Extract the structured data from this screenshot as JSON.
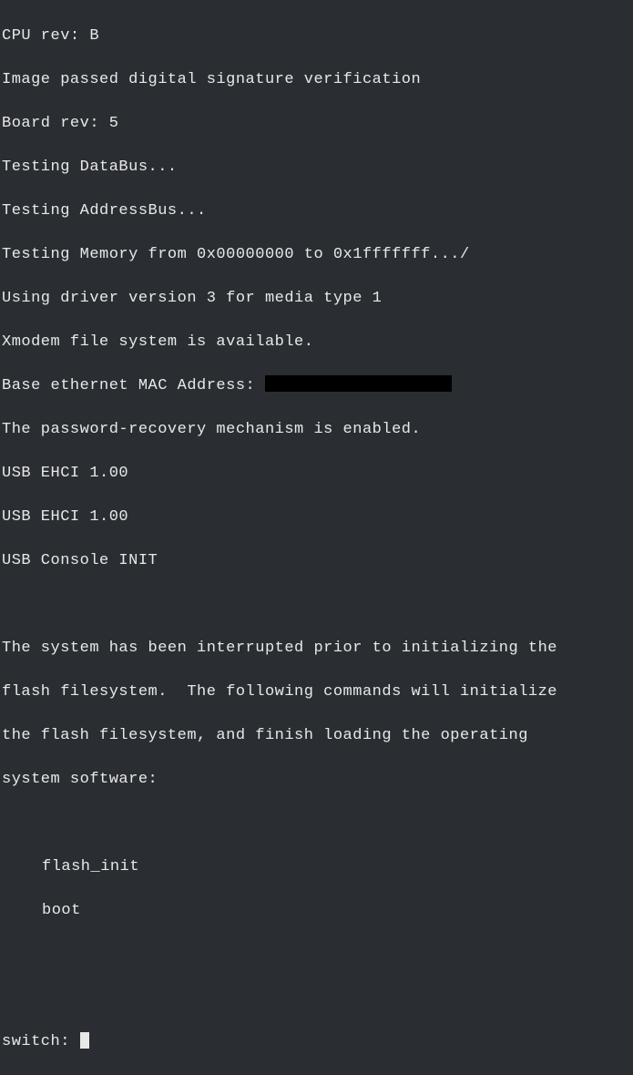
{
  "boot": {
    "cpu_rev": "CPU rev: B",
    "signature": "Image passed digital signature verification",
    "board_rev": "Board rev: 5",
    "test_databus": "Testing DataBus...",
    "test_addressbus": "Testing AddressBus...",
    "test_memory": "Testing Memory from 0x00000000 to 0x1fffffff.../",
    "driver": "Using driver version 3 for media type 1",
    "xmodem": "Xmodem file system is available.",
    "mac_label": "Base ethernet MAC Address: ",
    "password_recovery": "The password-recovery mechanism is enabled.",
    "usb_ehci_1": "USB EHCI 1.00",
    "usb_ehci_2": "USB EHCI 1.00",
    "usb_console": "USB Console INIT",
    "interrupt_msg_1": "The system has been interrupted prior to initializing the",
    "interrupt_msg_2": "flash filesystem.  The following commands will initialize",
    "interrupt_msg_3": "the flash filesystem, and finish loading the operating",
    "interrupt_msg_4": "system software:",
    "cmd_flash_init": "flash_init",
    "cmd_boot": "boot",
    "prompt": "switch: "
  }
}
